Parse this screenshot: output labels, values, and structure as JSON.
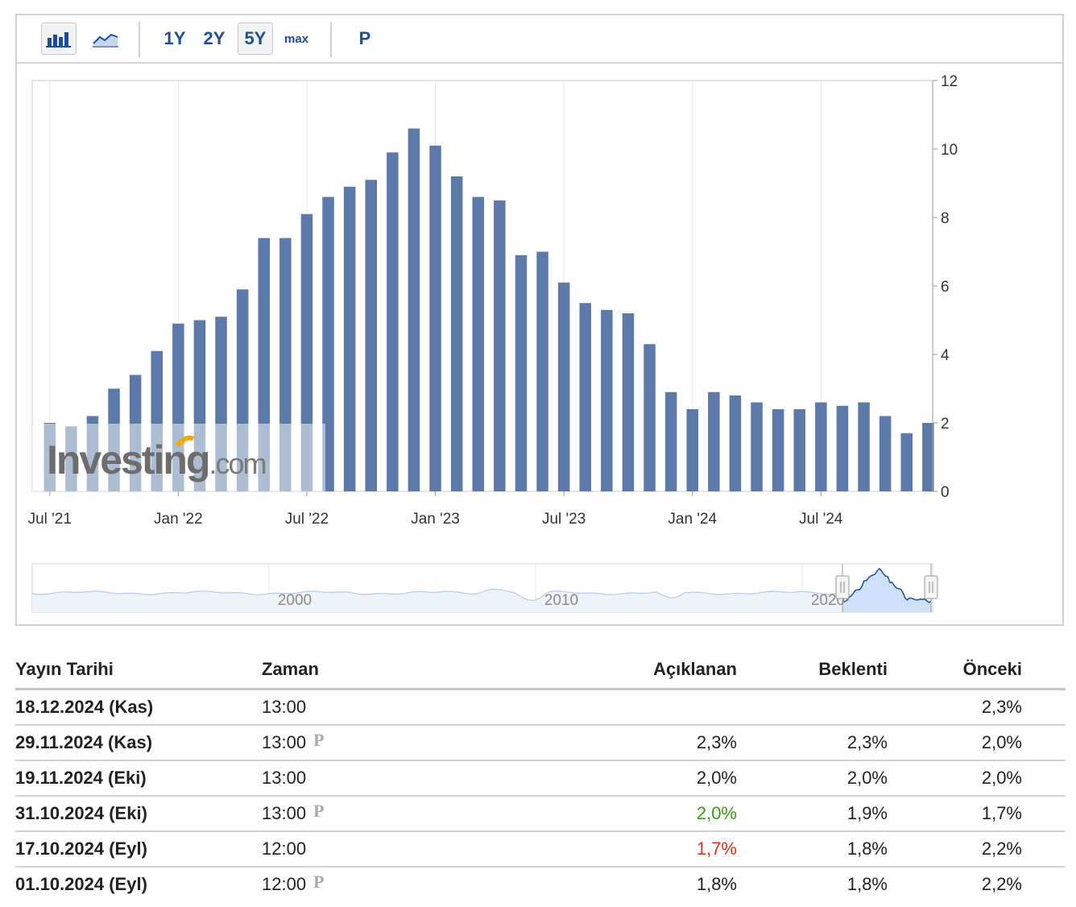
{
  "toolbar": {
    "bar_icon": "bar-chart-icon",
    "line_icon": "line-chart-icon",
    "ranges": [
      "1Y",
      "2Y",
      "5Y",
      "max"
    ],
    "active_range": "5Y",
    "p_label": "P"
  },
  "colors": {
    "bar": "#5b7aa9",
    "navigator_fill": "#cfe1f8",
    "navigator_line": "#1f4e99",
    "positive": "#3a9a17",
    "negative": "#e0301e",
    "accent": "#1f4e99"
  },
  "chart_data": {
    "type": "bar",
    "categories": [
      "2021-07",
      "2021-08",
      "2021-09",
      "2021-10",
      "2021-11",
      "2021-12",
      "2022-01",
      "2022-02",
      "2022-03",
      "2022-04",
      "2022-05",
      "2022-06",
      "2022-07",
      "2022-08",
      "2022-09",
      "2022-10",
      "2022-11",
      "2022-12",
      "2023-01",
      "2023-02",
      "2023-03",
      "2023-04",
      "2023-05",
      "2023-06",
      "2023-07",
      "2023-08",
      "2023-09",
      "2023-10",
      "2023-11",
      "2023-12",
      "2024-01",
      "2024-02",
      "2024-03",
      "2024-04",
      "2024-05",
      "2024-06",
      "2024-07",
      "2024-08",
      "2024-09",
      "2024-10",
      "2024-11"
    ],
    "values": [
      2.0,
      1.9,
      2.2,
      3.0,
      3.4,
      4.1,
      4.9,
      5.0,
      5.1,
      5.9,
      7.4,
      7.4,
      8.1,
      8.6,
      8.9,
      9.1,
      9.9,
      10.6,
      10.1,
      9.2,
      8.6,
      8.5,
      6.9,
      7.0,
      6.1,
      5.5,
      5.3,
      5.2,
      4.3,
      2.9,
      2.4,
      2.9,
      2.8,
      2.6,
      2.4,
      2.4,
      2.6,
      2.5,
      2.6,
      2.2,
      1.7,
      2.0
    ],
    "x_tick_labels": [
      "Jul '21",
      "Jan '22",
      "Jul '22",
      "Jan '23",
      "Jul '23",
      "Jan '24",
      "Jul '24"
    ],
    "y_ticks": [
      0,
      2,
      4,
      6,
      8,
      10,
      12
    ],
    "ylim": [
      0,
      12
    ],
    "grid": true,
    "y_axis_side": "right",
    "watermark": "Investing.com",
    "navigator_labels": [
      "2000",
      "2010",
      "2020"
    ]
  },
  "table": {
    "headers": {
      "date": "Yayın Tarihi",
      "time": "Zaman",
      "actual": "Açıklanan",
      "forecast": "Beklenti",
      "previous": "Önceki"
    },
    "rows": [
      {
        "date": "18.12.2024 (Kas)",
        "time": "13:00",
        "p": "",
        "actual": "",
        "actual_status": "neutral",
        "forecast": "",
        "previous": "2,3%"
      },
      {
        "date": "29.11.2024 (Kas)",
        "time": "13:00",
        "p": "P",
        "actual": "2,3%",
        "actual_status": "neutral",
        "forecast": "2,3%",
        "previous": "2,0%"
      },
      {
        "date": "19.11.2024 (Eki)",
        "time": "13:00",
        "p": "",
        "actual": "2,0%",
        "actual_status": "neutral",
        "forecast": "2,0%",
        "previous": "2,0%"
      },
      {
        "date": "31.10.2024 (Eki)",
        "time": "13:00",
        "p": "P",
        "actual": "2,0%",
        "actual_status": "positive",
        "forecast": "1,9%",
        "previous": "1,7%"
      },
      {
        "date": "17.10.2024 (Eyl)",
        "time": "12:00",
        "p": "",
        "actual": "1,7%",
        "actual_status": "negative",
        "forecast": "1,8%",
        "previous": "2,2%"
      },
      {
        "date": "01.10.2024 (Eyl)",
        "time": "12:00",
        "p": "P",
        "actual": "1,8%",
        "actual_status": "neutral",
        "forecast": "1,8%",
        "previous": "2,2%"
      }
    ]
  }
}
